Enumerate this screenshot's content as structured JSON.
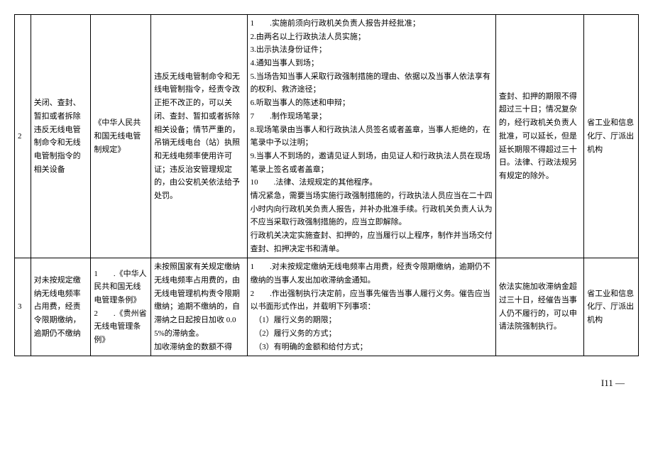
{
  "rows": [
    {
      "num": "2",
      "title": "关闭、查封、暂扣或者拆除违反无线电管制命令和无线电管制指令的相关设备",
      "basis": "《中华人民共和国无线电管制规定》",
      "criteria": "违反无线电管制命令和无线电管制指令，经责令改正拒不改正的，可以关闭、查封、暂扣或者拆除相关设备；情节严重的，吊销无线电台（站）执照和无线电频率使用许可证；违反治安管理规定的，由公安机关依法给予处罚。",
      "procedure": "1　　.实施前须向行政机关负责人报告并经批准；\n2.由两名以上行政执法人员实施；\n3.出示执法身份证件；\n4.通知当事人到场；\n5.当场告知当事人采取行政强制措施的理由、依据以及当事人依法享有的权利、救济途径；\n6.听取当事人的陈述和申辩；\n7　　.制作现场笔录；\n8.现场笔录由当事人和行政执法人员签名或者盖章，当事人拒绝的，在笔录中予以注明；\n9.当事人不到场的，邀请见证人到场，由见证人和行政执法人员在现场笔录上签名或者盖章；\n10　　.法律、法规规定的其他程序。\n情况紧急，需要当场实施行政强制措施的，行政执法人员应当在二十四小时内向行政机关负责人报告，并补办批准手续。行政机关负责人认为不应当采取行政强制措施的，应当立即解除。\n行政机关决定实施查封、扣押的，应当履行以上程序，制作并当场交付查封、扣押决定书和清单。",
      "limit": "查封、扣押的期限不得超过三十日；情况复杂的，经行政机关负责人批准，可以延长，但是延长期限不得超过三十日。法律、行政法规另有规定的除外。",
      "dept": "省工业和信息化厅、厅派出机构"
    },
    {
      "num": "3",
      "title": "对未按规定缴纳无线电频率占用费，经责令限期缴纳，逾期仍不缴纳",
      "basis": "1　　.《中华人民共和国无线电管理条例》\n2　　.《贵州省无线电管理条例》",
      "criteria": "未按照国家有关规定缴纳无线电频率占用费的，由无线电管理机构责令限期缴纳；逾期不缴纳的，自滞纳之日起按日加收 0.05%的滞纳金。\n加收滞纳金的数额不得",
      "procedure": "1　　.对未按规定缴纳无线电频率占用费，经责令限期缴纳，逾期仍不缴纳的当事人发出加收滞纳金通知。\n2　　.作出强制执行决定前，应当事先催告当事人履行义务。催告应当以书面形式作出，并载明下列事项：\n　（1）履行义务的期限；\n　（2）履行义务的方式；\n　（3）有明确的金额和给付方式；",
      "limit": "依法实施加收滞纳金超过三十日，经催告当事人仍不履行的，可以申请法院强制执行。",
      "dept": "省工业和信息化厅、厅派出机构"
    }
  ],
  "pageNumber": "I11 —"
}
